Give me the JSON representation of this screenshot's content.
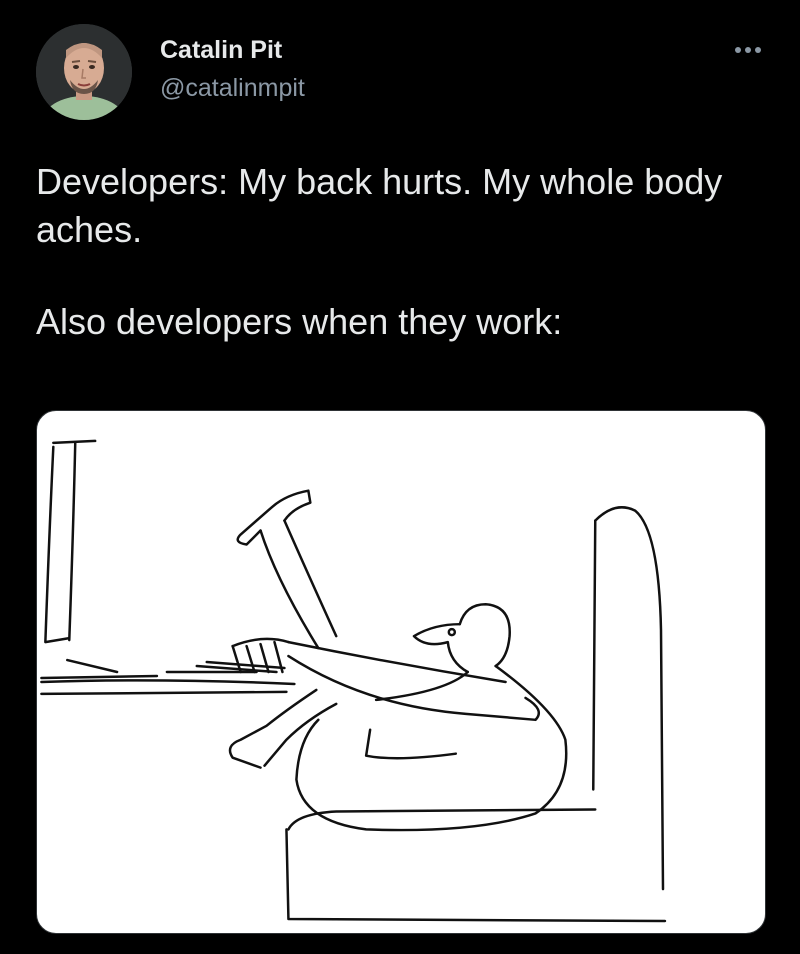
{
  "tweet": {
    "author": {
      "display_name": "Catalin Pit",
      "handle": "@catalinmpit"
    },
    "text_line_1": "Developers: My back hurts. My whole body aches.",
    "text_line_2": "Also developers when they work:"
  },
  "icons": {
    "more": "more-horizontal-icon",
    "avatar": "user-avatar-photo"
  },
  "colors": {
    "background": "#000000",
    "text_primary": "#e7e9ea",
    "text_secondary": "#8b98a5",
    "media_background": "#ffffff"
  }
}
